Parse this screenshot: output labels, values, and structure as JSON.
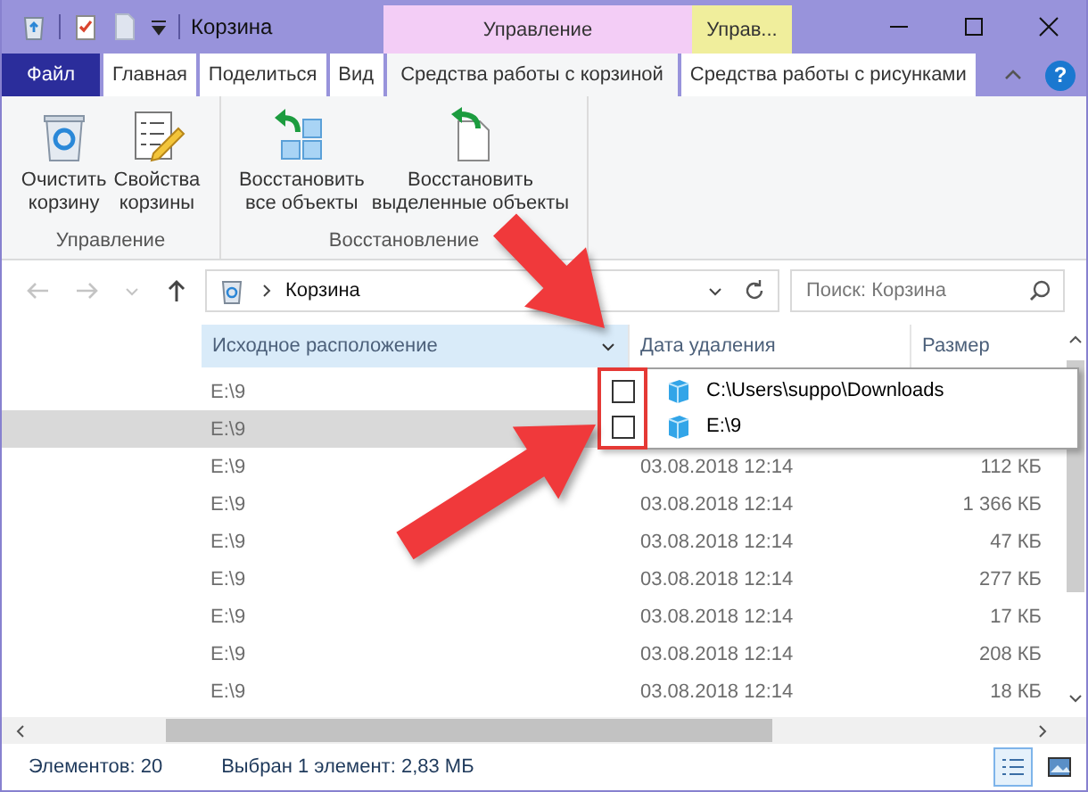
{
  "window": {
    "title": "Корзина",
    "context_tabs": [
      {
        "label": "Управление",
        "color": "#f3cdf6"
      },
      {
        "label": "Управ...",
        "color": "#f0ee9c"
      }
    ]
  },
  "ribbon": {
    "tabs": [
      {
        "label": "Файл",
        "kind": "file",
        "selected": false
      },
      {
        "label": "Главная",
        "kind": "tab",
        "selected": false
      },
      {
        "label": "Поделиться",
        "kind": "tab",
        "selected": false
      },
      {
        "label": "Вид",
        "kind": "tab",
        "selected": false
      },
      {
        "label": "Средства работы с корзиной",
        "kind": "tab",
        "selected": true
      },
      {
        "label": "Средства работы с рисунками",
        "kind": "tab",
        "selected": false
      }
    ],
    "help": "?",
    "groups": [
      {
        "label": "Управление",
        "buttons": [
          "Очистить\nкорзину",
          "Свойства\nкорзины"
        ]
      },
      {
        "label": "Восстановление",
        "buttons": [
          "Восстановить\nвсе объекты",
          "Восстановить\nвыделенные объекты"
        ]
      }
    ]
  },
  "address": {
    "path": "Корзина"
  },
  "search": {
    "placeholder": "Поиск: Корзина"
  },
  "table": {
    "columns": [
      {
        "label": "Исходное расположение",
        "selected": true
      },
      {
        "label": "Дата удаления",
        "selected": false
      },
      {
        "label": "Размер",
        "selected": false
      }
    ],
    "rows": [
      {
        "location": "E:\\9",
        "selected": false
      },
      {
        "location": "E:\\9",
        "selected": true
      },
      {
        "location": "E:\\9",
        "date": "03.08.2018 12:14",
        "size": "112 КБ",
        "selected": false
      },
      {
        "location": "E:\\9",
        "date": "03.08.2018 12:14",
        "size": "1 366 КБ",
        "selected": false
      },
      {
        "location": "E:\\9",
        "date": "03.08.2018 12:14",
        "size": "47 КБ",
        "selected": false
      },
      {
        "location": "E:\\9",
        "date": "03.08.2018 12:14",
        "size": "277 КБ",
        "selected": false
      },
      {
        "location": "E:\\9",
        "date": "03.08.2018 12:14",
        "size": "17 КБ",
        "selected": false
      },
      {
        "location": "E:\\9",
        "date": "03.08.2018 12:14",
        "size": "208 КБ",
        "selected": false
      },
      {
        "location": "E:\\9",
        "date": "03.08.2018 12:14",
        "size": "18 КБ",
        "selected": false
      }
    ]
  },
  "filter_popup": {
    "items": [
      {
        "label": "C:\\Users\\suppo\\Downloads",
        "checked": false
      },
      {
        "label": "E:\\9",
        "checked": false
      }
    ]
  },
  "status_bar": {
    "item_count": "Элементов: 20",
    "selection": "Выбран 1 элемент: 2,83 МБ",
    "views": [
      {
        "selected": true
      },
      {
        "selected": false
      }
    ]
  }
}
